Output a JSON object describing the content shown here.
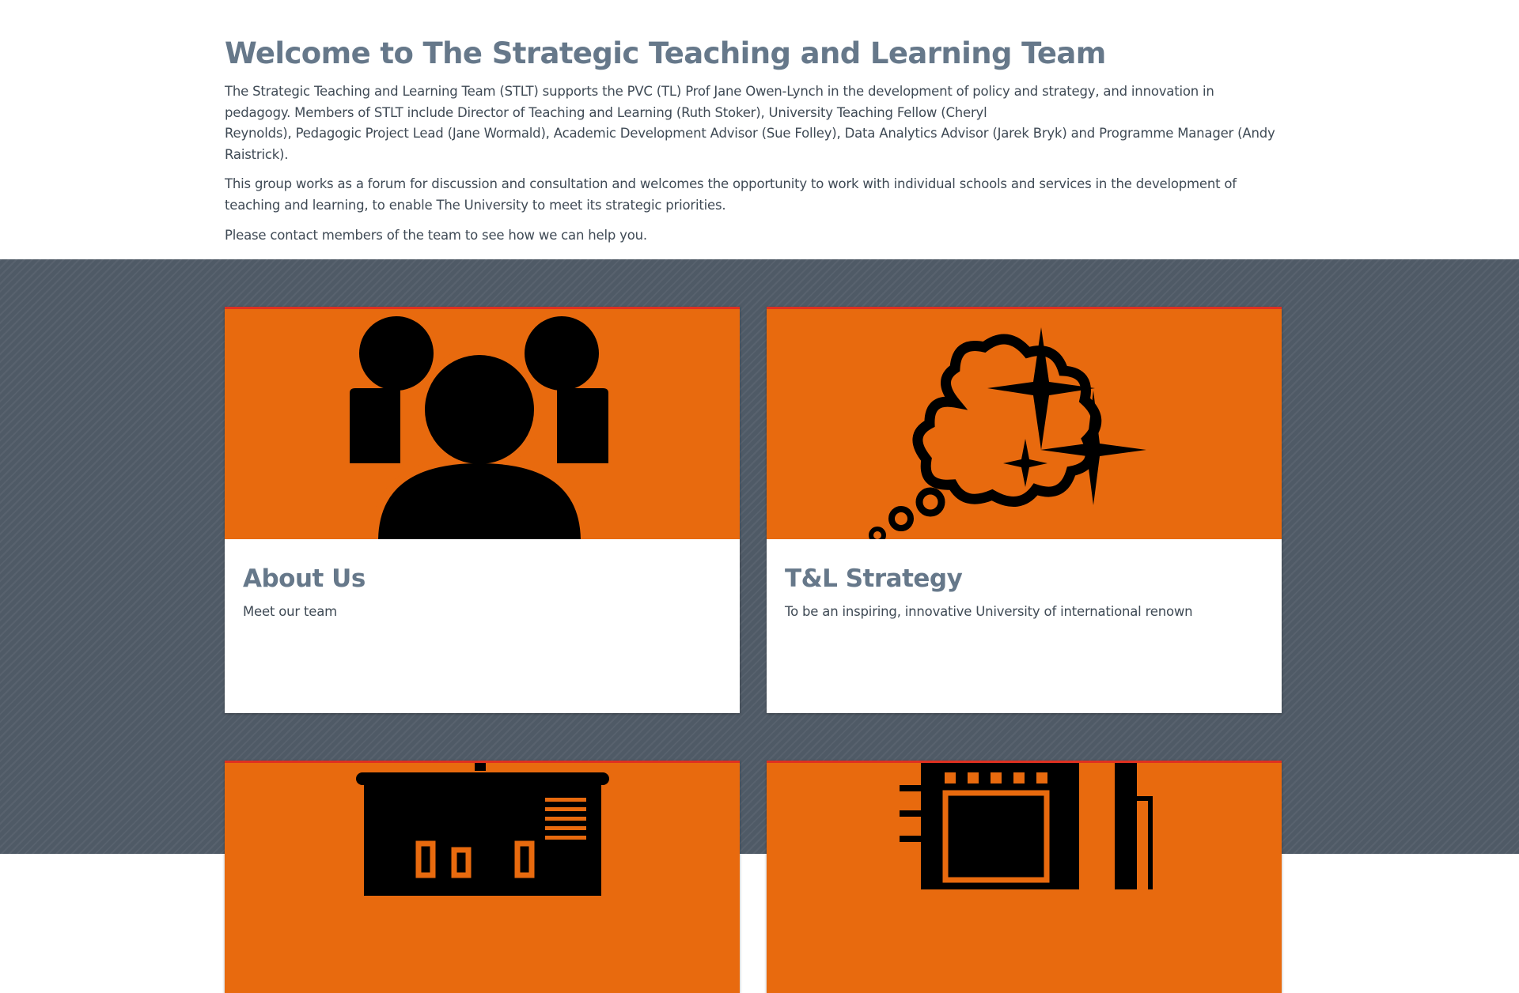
{
  "intro": {
    "title": "Welcome to The Strategic Teaching and Learning Team",
    "paragraph1_line1": "The Strategic Teaching and Learning Team (STLT) supports the PVC (TL) Prof Jane Owen-Lynch in the development of policy and strategy, and innovation in",
    "paragraph1_line2": "pedagogy. Members of STLT include Director of Teaching and Learning (Ruth Stoker), University Teaching Fellow (Cheryl",
    "paragraph1_line3": "Reynolds), Pedagogic Project Lead (Jane Wormald), Academic Development Advisor (Sue Folley), Data Analytics Advisor (Jarek Bryk) and Programme Manager (Andy Raistrick).",
    "paragraph2": "This group works as a forum for discussion and consultation and welcomes the opportunity to work with individual schools and services in the development of teaching and learning, to enable The University to meet its strategic priorities.",
    "paragraph3": "Please contact members of the team to see how we can help you."
  },
  "cards": [
    {
      "title": "About Us",
      "description": "Meet our team",
      "icon": "team-icon"
    },
    {
      "title": "T&L Strategy",
      "description": "To be an inspiring, innovative University of international renown",
      "icon": "thought-bubble-icon"
    },
    {
      "icon": "presentation-board-icon"
    },
    {
      "icon": "notebook-pen-icon"
    }
  ],
  "colors": {
    "heading": "#66788a",
    "card_banner": "#e86a0e",
    "card_banner_border": "#e03020",
    "background_dark": "#4f5a66"
  }
}
